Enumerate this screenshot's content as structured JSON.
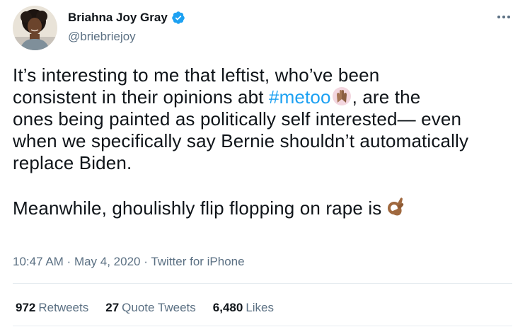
{
  "author": {
    "display_name": "Briahna Joy Gray",
    "handle": "@briebriejoy",
    "verified": true,
    "avatar_icon": "profile-photo"
  },
  "tweet": {
    "lines": [
      "It’s interesting to me that leftist, who’ve been",
      "consistent in their opinions abt ",
      "ones being painted as politically self interested— even",
      "when we specifically say Bernie shouldn’t automatically",
      "replace Biden."
    ],
    "hashtag": "#metoo",
    "after_hashtag": ", are the",
    "hashtag_emoji": "raised-hands-emoji",
    "para2": "Meanwhile, ghoulishly flip flopping on rape is ",
    "para2_emoji": "ok-hand-emoji"
  },
  "meta": {
    "time": "10:47 AM",
    "separator1": " · ",
    "date": "May 4, 2020",
    "separator2": " · ",
    "source": "Twitter for iPhone"
  },
  "stats": {
    "retweets_count": "972",
    "retweets_label": "Retweets",
    "quotes_count": "27",
    "quotes_label": "Quote Tweets",
    "likes_count": "6,480",
    "likes_label": "Likes"
  },
  "colors": {
    "link": "#1da1f2",
    "verified": "#1da1f2",
    "secondary_text": "#5b7083",
    "primary_text": "#0f1419"
  }
}
